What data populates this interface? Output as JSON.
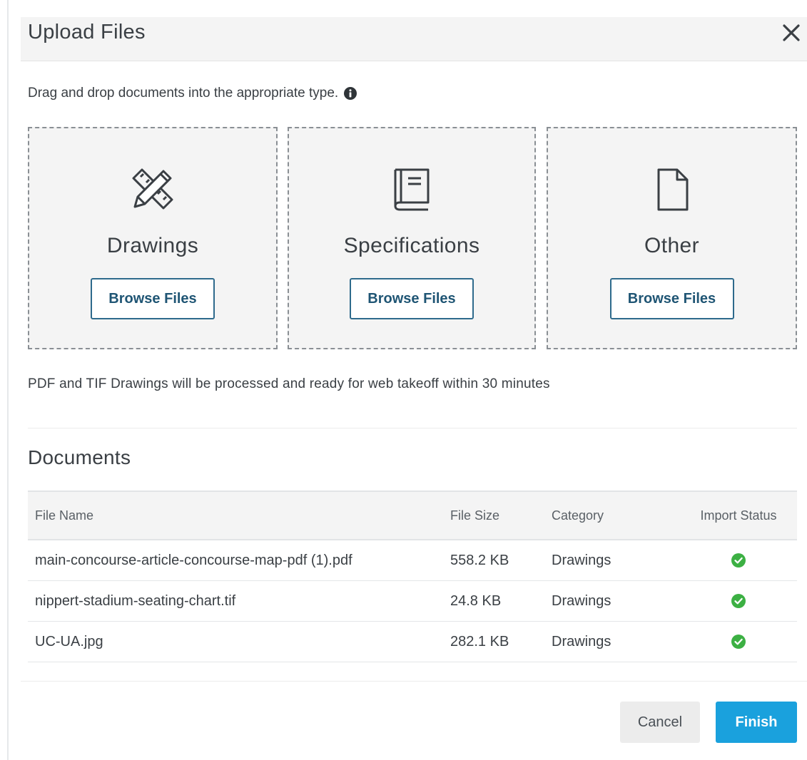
{
  "dialog": {
    "title": "Upload Files"
  },
  "instruction": "Drag and drop documents into the appropriate type.",
  "dropzones": [
    {
      "label": "Drawings",
      "icon": "pencil-ruler-icon",
      "button": "Browse Files"
    },
    {
      "label": "Specifications",
      "icon": "book-icon",
      "button": "Browse Files"
    },
    {
      "label": "Other",
      "icon": "document-icon",
      "button": "Browse Files"
    }
  ],
  "note": "PDF and TIF Drawings will be processed and ready for web takeoff within 30 minutes",
  "documents": {
    "title": "Documents",
    "columns": [
      "File Name",
      "File Size",
      "Category",
      "Import Status"
    ],
    "rows": [
      {
        "name": "main-concourse-article-concourse-map-pdf (1).pdf",
        "size": "558.2 KB",
        "category": "Drawings",
        "status": "complete"
      },
      {
        "name": "nippert-stadium-seating-chart.tif",
        "size": "24.8 KB",
        "category": "Drawings",
        "status": "complete"
      },
      {
        "name": "UC-UA.jpg",
        "size": "282.1 KB",
        "category": "Drawings",
        "status": "complete"
      }
    ]
  },
  "footer": {
    "cancel_label": "Cancel",
    "finish_label": "Finish"
  },
  "colors": {
    "primary": "#1aa1dd",
    "button_border": "#2e6a8c",
    "success": "#3cb043"
  }
}
